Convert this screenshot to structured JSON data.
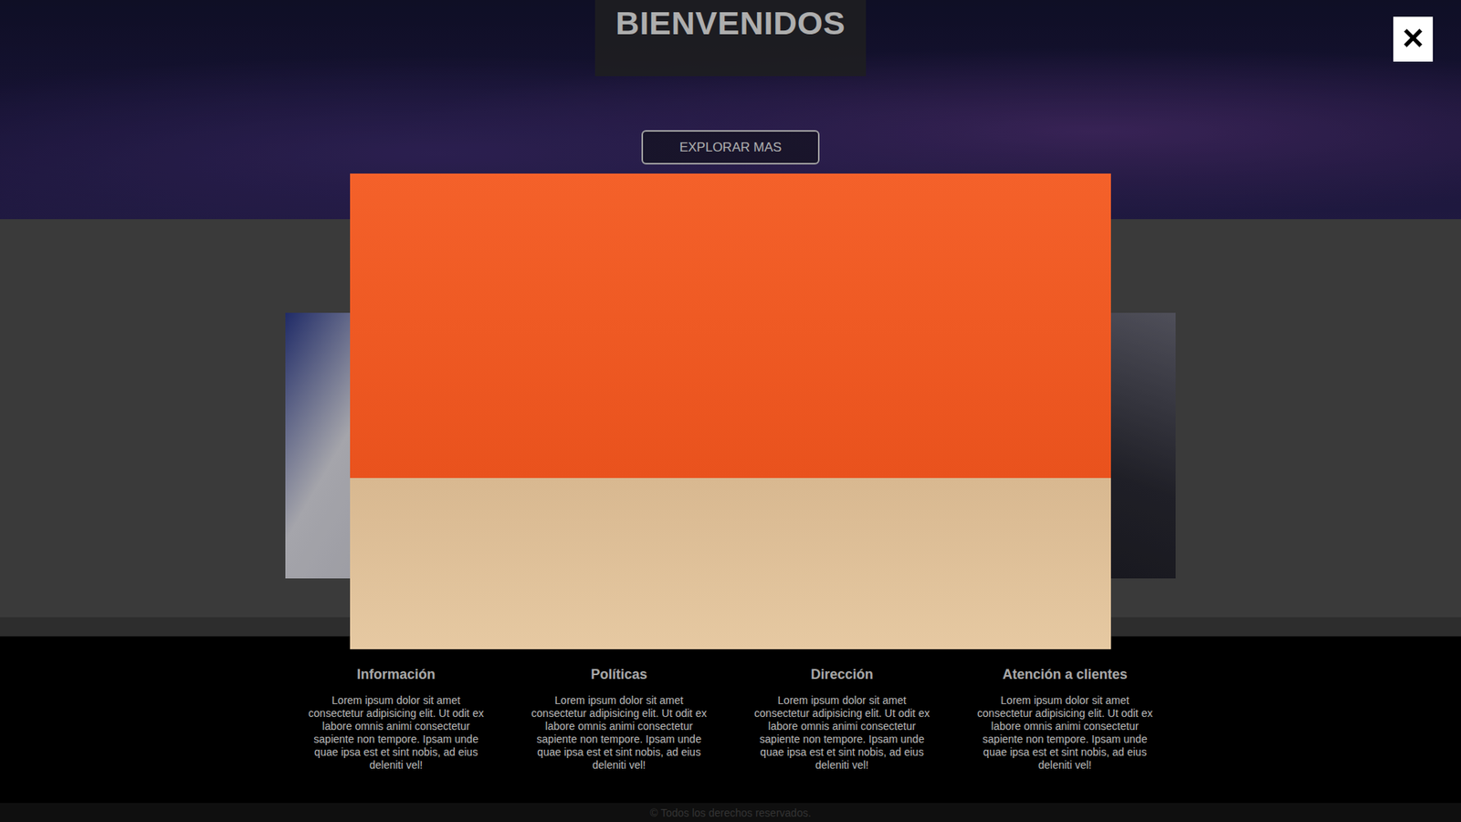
{
  "hero": {
    "title": "BIENVENIDOS",
    "button": "EXPLORAR MAS"
  },
  "footer": {
    "columns": [
      {
        "title": "Información",
        "text": "Lorem ipsum dolor sit amet consectetur adipisicing elit. Ut odit ex labore omnis animi consectetur sapiente non tempore. Ipsam unde quae ipsa est et sint nobis, ad eius deleniti vel!"
      },
      {
        "title": "Políticas",
        "text": "Lorem ipsum dolor sit amet consectetur adipisicing elit. Ut odit ex labore omnis animi consectetur sapiente non tempore. Ipsam unde quae ipsa est et sint nobis, ad eius deleniti vel!"
      },
      {
        "title": "Dirección",
        "text": "Lorem ipsum dolor sit amet consectetur adipisicing elit. Ut odit ex labore omnis animi consectetur sapiente non tempore. Ipsam unde quae ipsa est et sint nobis, ad eius deleniti vel!"
      },
      {
        "title": "Atención a clientes",
        "text": "Lorem ipsum dolor sit amet consectetur adipisicing elit. Ut odit ex labore omnis animi consectetur sapiente non tempore. Ipsam unde quae ipsa est et sint nobis, ad eius deleniti vel!"
      }
    ],
    "copyright": "© Todos los derechos reservados."
  },
  "lightbox": {
    "open": true,
    "close": "×"
  }
}
